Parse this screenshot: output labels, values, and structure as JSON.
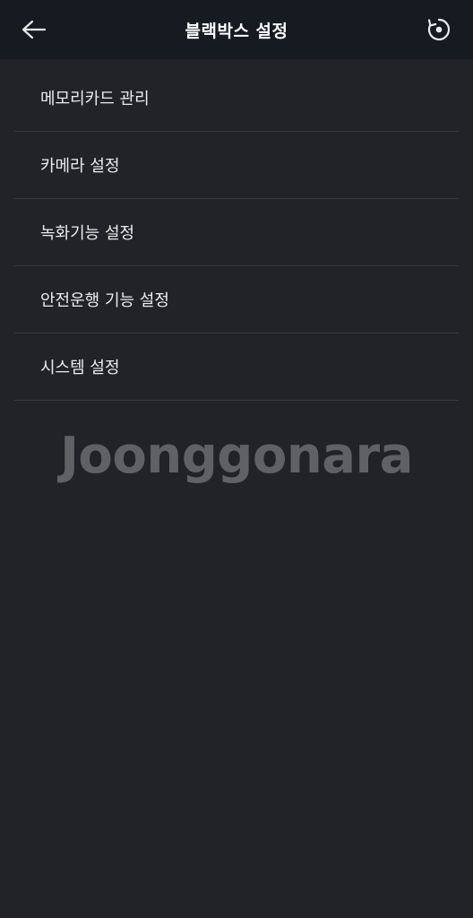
{
  "header": {
    "title": "블랙박스 설정",
    "back_icon": "arrow-left-icon",
    "reset_icon": "reset-icon"
  },
  "menu": {
    "items": [
      {
        "label": "메모리카드 관리"
      },
      {
        "label": "카메라 설정"
      },
      {
        "label": "녹화기능 설정"
      },
      {
        "label": "안전운행 기능 설정"
      },
      {
        "label": "시스템 설정"
      }
    ]
  },
  "watermark": {
    "text": "Joonggonara"
  },
  "colors": {
    "background": "#212329",
    "header": "#161a21",
    "divider": "#363941",
    "text": "#ececec"
  }
}
